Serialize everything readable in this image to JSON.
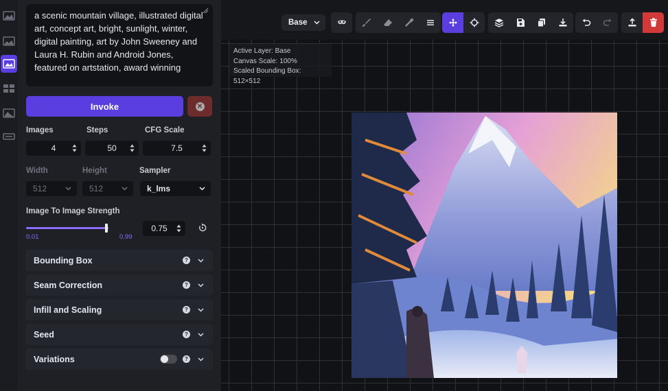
{
  "rail": {
    "icons": [
      "text-to-image-icon",
      "image-to-image-icon",
      "unified-canvas-icon",
      "outpainting-icon",
      "gallery-icon",
      "postprocess-icon"
    ]
  },
  "prompt": {
    "text": "a scenic mountain village, illustrated digital art, concept art, bright, sunlight, winter, digital painting, art by John Sweeney and Laura H. Rubin and Android Jones, featured on artstation, award winning"
  },
  "actions": {
    "invoke_label": "Invoke"
  },
  "params": {
    "images_label": "Images",
    "images_value": "4",
    "steps_label": "Steps",
    "steps_value": "50",
    "cfg_label": "CFG Scale",
    "cfg_value": "7.5",
    "width_label": "Width",
    "width_value": "512",
    "height_label": "Height",
    "height_value": "512",
    "sampler_label": "Sampler",
    "sampler_value": "k_lms",
    "strength_label": "Image To Image Strength",
    "strength_min": "0.01",
    "strength_max": "0.99",
    "strength_value": "0.75"
  },
  "accordions": [
    {
      "label": "Bounding Box"
    },
    {
      "label": "Seam Correction"
    },
    {
      "label": "Infill and Scaling"
    },
    {
      "label": "Seed"
    },
    {
      "label": "Variations"
    }
  ],
  "canvas": {
    "layer_select": "Base",
    "info_active_layer": "Active Layer: Base",
    "info_canvas_scale": "Canvas Scale: 100%",
    "info_bbox": "Scaled Bounding Box: 512×512"
  },
  "colors": {
    "accent": "#5b3ee0",
    "danger": "#d23a3a",
    "panel": "#1f2026",
    "canvas_bg": "#111215"
  }
}
